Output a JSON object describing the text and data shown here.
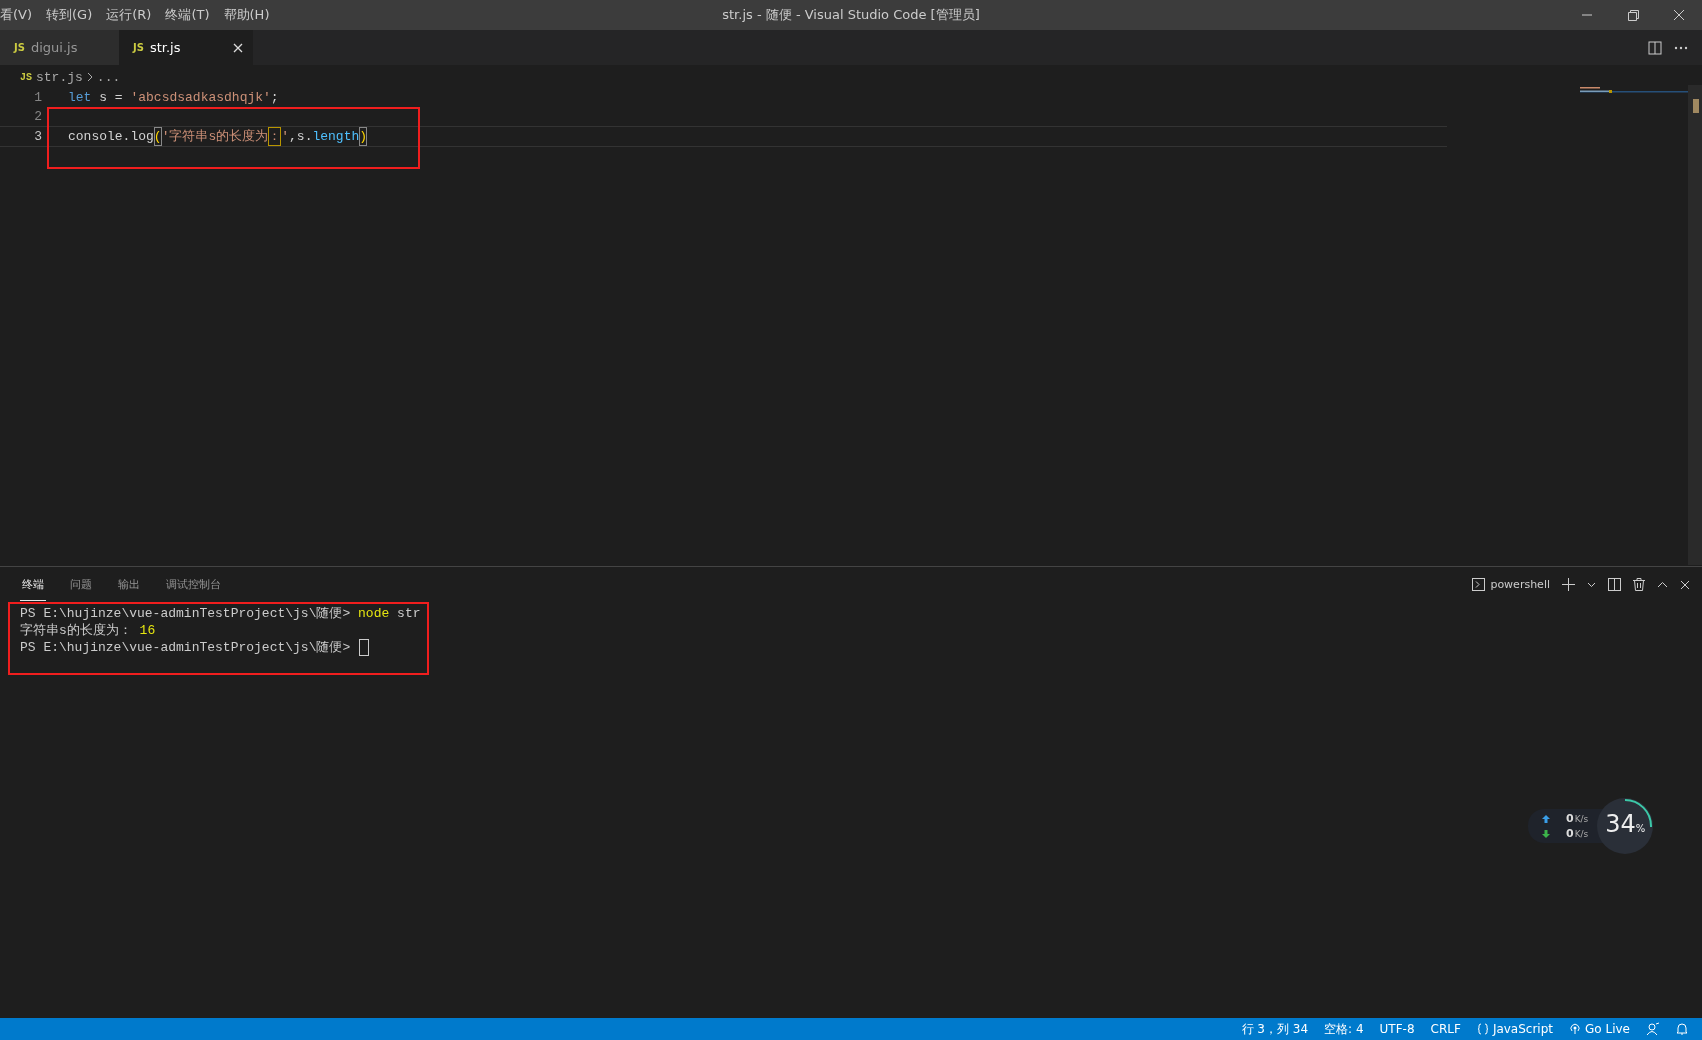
{
  "window": {
    "title": "str.js - 随便 - Visual Studio Code [管理员]",
    "menu": [
      "看(V)",
      "转到(G)",
      "运行(R)",
      "终端(T)",
      "帮助(H)"
    ]
  },
  "editor_tabs": [
    {
      "badge": "JS",
      "label": "digui.js",
      "selected": false
    },
    {
      "badge": "JS",
      "label": "str.js",
      "selected": true
    }
  ],
  "breadcrumb": {
    "badge": "JS",
    "file": "str.js",
    "rest": "..."
  },
  "code": [
    {
      "number": "1",
      "current": false,
      "tokens": [
        {
          "text": "let",
          "kind": "keyword"
        },
        {
          "text": " s = ",
          "kind": "plain"
        },
        {
          "text": "'abcsdsadkasdhqjk'",
          "kind": "string"
        },
        {
          "text": ";",
          "kind": "plain"
        }
      ]
    },
    {
      "number": "2",
      "current": false
    },
    {
      "number": "3",
      "current": true,
      "tokens": [
        {
          "text": "console.log",
          "kind": "plain"
        },
        {
          "text": "(",
          "kind": "bracket"
        },
        {
          "text": "'字符串s的长度为",
          "kind": "string"
        },
        {
          "text": "：",
          "kind": "string_boxed"
        },
        {
          "text": "'",
          "kind": "string"
        },
        {
          "text": ",s.",
          "kind": "plain"
        },
        {
          "text": "length",
          "kind": "property"
        },
        {
          "text": ")",
          "kind": "bracket"
        }
      ]
    }
  ],
  "annotations": {
    "editor_frame": true,
    "terminal_frame": true
  },
  "panel_tabs": [
    {
      "label": "终端",
      "selected": true
    },
    {
      "label": "问题",
      "selected": false
    },
    {
      "label": "输出",
      "selected": false
    },
    {
      "label": "调试控制台",
      "selected": false
    }
  ],
  "terminal_profile": "powershell",
  "terminal": [
    {
      "cursor": false,
      "segments": [
        {
          "text": "PS E:\\hujinze\\vue-adminTestProject\\js\\随便> ",
          "kind": "plain"
        },
        {
          "text": "node",
          "kind": "command"
        },
        {
          "text": " str",
          "kind": "plain"
        }
      ]
    },
    {
      "cursor": false,
      "segments": [
        {
          "text": "字符串s的长度为： ",
          "kind": "plain"
        },
        {
          "text": "16",
          "kind": "number"
        }
      ]
    },
    {
      "cursor": true,
      "segments": [
        {
          "text": "PS E:\\hujinze\\vue-adminTestProject\\js\\随便> ",
          "kind": "plain"
        }
      ]
    }
  ],
  "network_widget": {
    "upload": "0",
    "download": "0",
    "upload_unit": "K/s",
    "download_unit": "K/s",
    "usage": "34",
    "usage_unit": "%",
    "level": 0.34
  },
  "status_bar": [
    {
      "text": "行 3，列 34",
      "kind": "text"
    },
    {
      "text": "空格: 4",
      "kind": "text"
    },
    {
      "text": "UTF-8",
      "kind": "text"
    },
    {
      "text": "CRLF",
      "kind": "text"
    },
    {
      "text": "JavaScript",
      "kind": "language"
    },
    {
      "text": "Go Live",
      "kind": "live"
    },
    {
      "kind": "feedback"
    },
    {
      "kind": "bell"
    }
  ]
}
